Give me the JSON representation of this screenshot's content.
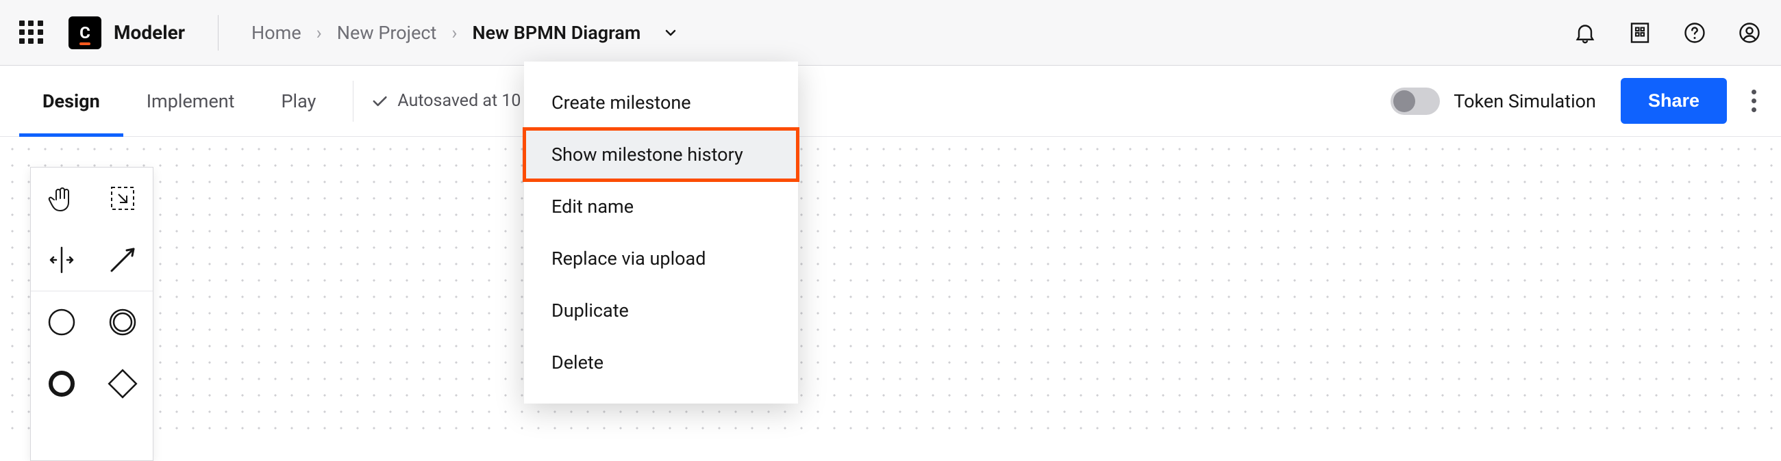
{
  "header": {
    "brand_initial": "C",
    "brand_name": "Modeler",
    "breadcrumbs": [
      {
        "label": "Home",
        "current": false
      },
      {
        "label": "New Project",
        "current": false
      },
      {
        "label": "New BPMN Diagram",
        "current": true
      }
    ]
  },
  "tabs": {
    "items": [
      {
        "label": "Design",
        "active": true
      },
      {
        "label": "Implement",
        "active": false
      },
      {
        "label": "Play",
        "active": false
      }
    ],
    "autosave_label": "Autosaved at 10"
  },
  "toolbar_right": {
    "token_sim_label": "Token Simulation",
    "token_sim_on": false,
    "share_label": "Share"
  },
  "dropdown": {
    "items": [
      {
        "label": "Create milestone",
        "highlighted": false
      },
      {
        "label": "Show milestone history",
        "highlighted": true
      },
      {
        "label": "Edit name",
        "highlighted": false
      },
      {
        "label": "Replace via upload",
        "highlighted": false
      },
      {
        "label": "Duplicate",
        "highlighted": false
      },
      {
        "label": "Delete",
        "highlighted": false
      }
    ]
  },
  "palette": {
    "tool_labels": [
      "hand-tool",
      "lasso-tool",
      "space-tool",
      "connect-tool",
      "start-event",
      "end-event",
      "intermediate-event",
      "gateway"
    ]
  },
  "colors": {
    "accent": "#0f62fe",
    "highlight_border": "#fc4c02"
  }
}
